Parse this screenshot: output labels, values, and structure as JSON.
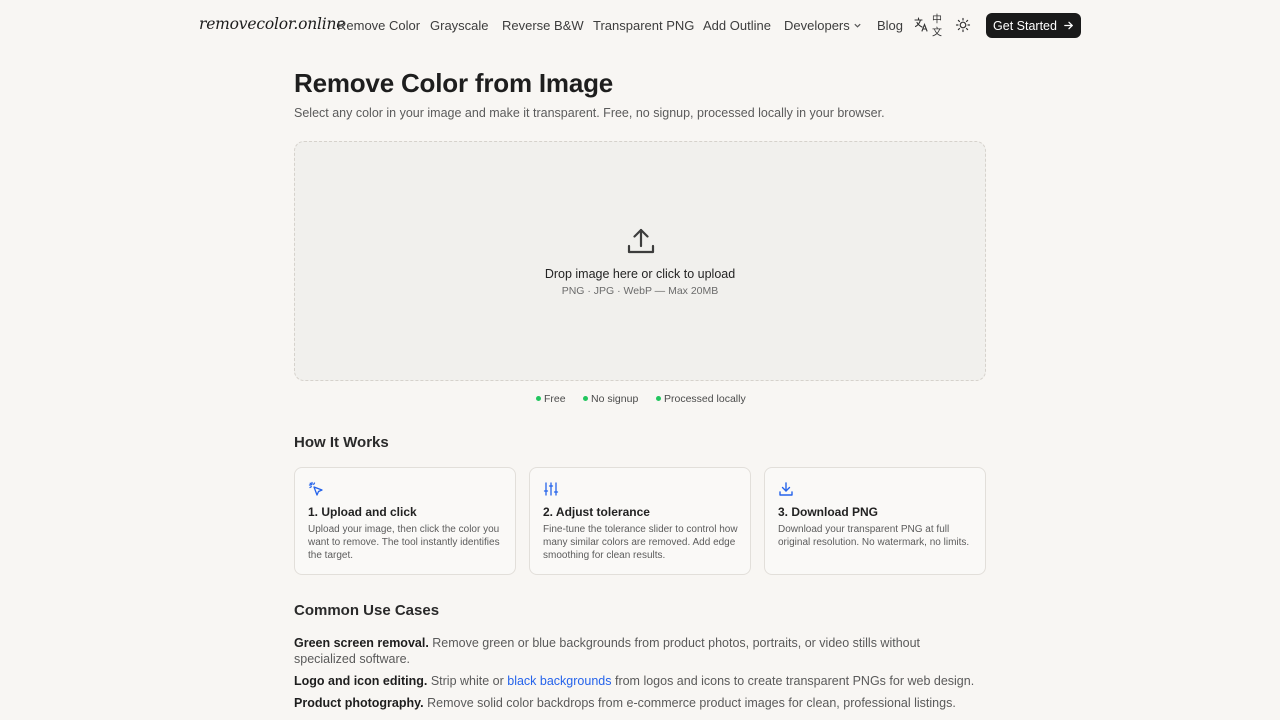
{
  "brand": {
    "name": "removecolor.online"
  },
  "nav": {
    "items": [
      "Remove Color",
      "Grayscale",
      "Reverse B&W",
      "Transparent PNG",
      "Add Outline",
      "Developers",
      "Blog"
    ],
    "lang_icon": "translate-icon",
    "lang_text_top": "中",
    "lang_text_bottom": "文",
    "theme_icon": "sun-icon",
    "cta_label": "Get Started"
  },
  "hero": {
    "title": "Remove Color from Image",
    "subtitle": "Select any color in your image and make it transparent. Free, no signup, processed locally in your browser."
  },
  "dropzone": {
    "icon": "upload-icon",
    "main_text": "Drop image here or click to upload",
    "sub_text": "PNG · JPG · WebP — Max 20MB"
  },
  "badges": [
    "Free",
    "No signup",
    "Processed locally"
  ],
  "how_it_works": {
    "heading": "How It Works",
    "steps": [
      {
        "icon": "click-cursor-icon",
        "title": "1. Upload and click",
        "text": "Upload your image, then click the color you want to remove. The tool instantly identifies the target."
      },
      {
        "icon": "sliders-icon",
        "title": "2. Adjust tolerance",
        "text": "Fine-tune the tolerance slider to control how many similar colors are removed. Add edge smoothing for clean results."
      },
      {
        "icon": "download-icon",
        "title": "3. Download PNG",
        "text": "Download your transparent PNG at full original resolution. No watermark, no limits."
      }
    ]
  },
  "use_cases": {
    "heading": "Common Use Cases",
    "items": [
      {
        "title": "Green screen removal.",
        "text": "Remove green or blue backgrounds from product photos, portraits, or video stills without specialized software."
      },
      {
        "title": "Logo and icon editing.",
        "text_before": "Strip white or",
        "link": "black backgrounds",
        "text_after": "from logos and icons to create transparent PNGs for web design."
      },
      {
        "title": "Product photography.",
        "text": "Remove solid color backdrops from e-commerce product images for clean, professional listings."
      }
    ]
  },
  "colors": {
    "accent": "#2563eb",
    "badge_dot": "#22c55e",
    "cta_bg": "#1a1a1a"
  }
}
